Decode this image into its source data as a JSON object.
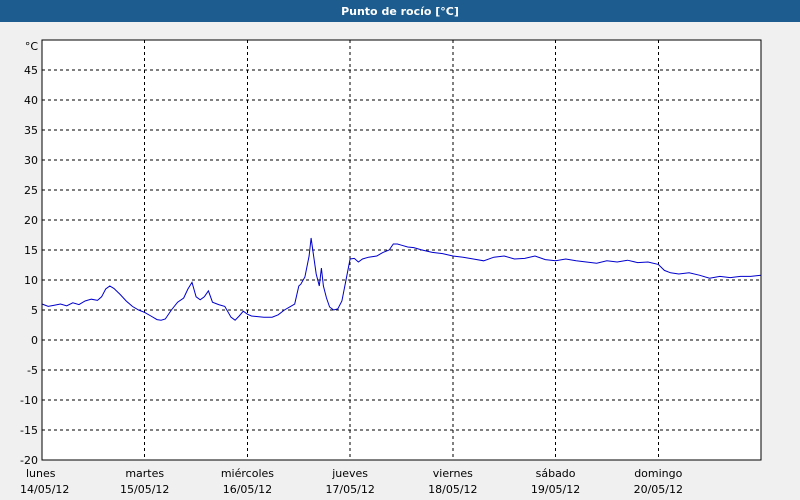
{
  "window": {
    "title": "Punto de rocío [°C]"
  },
  "chart_data": {
    "type": "line",
    "title": "Punto de rocío [°C]",
    "ylabel": "°C",
    "xlabel": "",
    "ylim": [
      -20,
      50
    ],
    "xlim": [
      0,
      7
    ],
    "grid": true,
    "y_ticks": [
      -20,
      -15,
      -10,
      -5,
      0,
      5,
      10,
      15,
      20,
      25,
      30,
      35,
      40,
      45
    ],
    "x_ticks": [
      {
        "x": 0,
        "day": "lunes",
        "date": "14/05/12"
      },
      {
        "x": 1,
        "day": "martes",
        "date": "15/05/12"
      },
      {
        "x": 2,
        "day": "miércoles",
        "date": "16/05/12"
      },
      {
        "x": 3,
        "day": "jueves",
        "date": "17/05/12"
      },
      {
        "x": 4,
        "day": "viernes",
        "date": "18/05/12"
      },
      {
        "x": 5,
        "day": "sábado",
        "date": "19/05/12"
      },
      {
        "x": 6,
        "day": "domingo",
        "date": "20/05/12"
      }
    ],
    "colors": {
      "line": "#0000cc",
      "grid": "#000000",
      "plot_bg": "#ffffff"
    },
    "series": [
      {
        "x": [
          0,
          0.06,
          0.12,
          0.18,
          0.24,
          0.3,
          0.36,
          0.42,
          0.48,
          0.54,
          0.58,
          0.62,
          0.66,
          0.7,
          0.76,
          0.82,
          0.88,
          0.94,
          1.0,
          1.06,
          1.12,
          1.16,
          1.2,
          1.26,
          1.32,
          1.38,
          1.42,
          1.46,
          1.5,
          1.54,
          1.58,
          1.62,
          1.66,
          1.72,
          1.78,
          1.84,
          1.88,
          1.92,
          1.96,
          2.0,
          2.04,
          2.1,
          2.16,
          2.24,
          2.3,
          2.36,
          2.42,
          2.46,
          2.5,
          2.52,
          2.56,
          2.6,
          2.62,
          2.64,
          2.67,
          2.7,
          2.72,
          2.74,
          2.77,
          2.8,
          2.84,
          2.88,
          2.92,
          2.96,
          3.0,
          3.04,
          3.08,
          3.12,
          3.18,
          3.26,
          3.32,
          3.38,
          3.42,
          3.46,
          3.5,
          3.56,
          3.62,
          3.7,
          3.8,
          3.9,
          4.0,
          4.1,
          4.2,
          4.3,
          4.4,
          4.5,
          4.6,
          4.7,
          4.8,
          4.9,
          5.0,
          5.1,
          5.2,
          5.3,
          5.4,
          5.5,
          5.6,
          5.7,
          5.8,
          5.9,
          6.0,
          6.06,
          6.12,
          6.2,
          6.3,
          6.4,
          6.5,
          6.6,
          6.7,
          6.8,
          6.9,
          7.0
        ],
        "y": [
          6.0,
          5.6,
          5.8,
          6.0,
          5.7,
          6.2,
          5.9,
          6.5,
          6.8,
          6.6,
          7.2,
          8.5,
          9.0,
          8.6,
          7.6,
          6.5,
          5.6,
          5.0,
          4.6,
          4.0,
          3.4,
          3.3,
          3.5,
          5.0,
          6.3,
          7.0,
          8.5,
          9.6,
          7.2,
          6.7,
          7.2,
          8.2,
          6.3,
          5.9,
          5.6,
          3.8,
          3.3,
          4.0,
          4.8,
          4.3,
          4.0,
          3.9,
          3.8,
          3.8,
          4.2,
          5.0,
          5.6,
          6.0,
          9.0,
          9.3,
          10.5,
          14.0,
          17.0,
          14.5,
          11.0,
          9.0,
          12.0,
          9.0,
          7.0,
          5.5,
          5.0,
          5.2,
          6.5,
          10.0,
          13.5,
          13.6,
          13.0,
          13.5,
          13.8,
          14.0,
          14.6,
          15.0,
          16.0,
          16.0,
          15.8,
          15.5,
          15.4,
          15.0,
          14.6,
          14.4,
          14.0,
          13.8,
          13.5,
          13.2,
          13.8,
          14.0,
          13.5,
          13.6,
          14.0,
          13.4,
          13.2,
          13.5,
          13.2,
          13.0,
          12.8,
          13.2,
          13.0,
          13.3,
          12.9,
          13.0,
          12.6,
          11.6,
          11.2,
          11.0,
          11.2,
          10.8,
          10.3,
          10.6,
          10.4,
          10.6,
          10.6,
          10.8
        ]
      }
    ]
  }
}
